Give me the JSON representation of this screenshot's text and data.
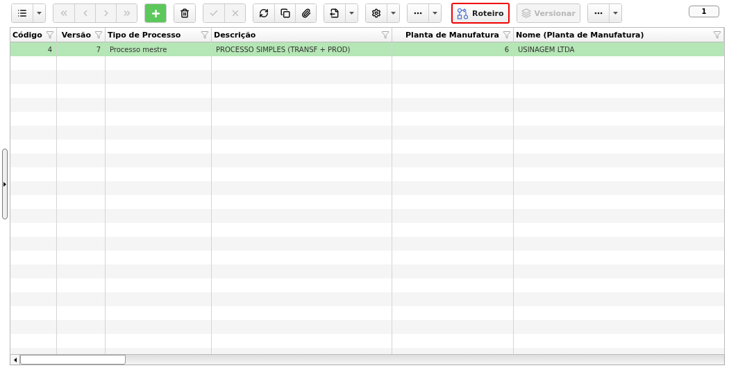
{
  "toolbar": {
    "groups": [
      {
        "buttons": [
          {
            "kind": "list",
            "disabled": false
          },
          {
            "kind": "caret",
            "disabled": false
          }
        ]
      },
      {
        "buttons": [
          {
            "kind": "first",
            "disabled": true
          },
          {
            "kind": "prev",
            "disabled": true
          },
          {
            "kind": "next",
            "disabled": true
          },
          {
            "kind": "last",
            "disabled": true
          }
        ]
      },
      {
        "buttons": [
          {
            "kind": "add",
            "disabled": false
          }
        ]
      },
      {
        "buttons": [
          {
            "kind": "delete",
            "disabled": false
          }
        ]
      },
      {
        "buttons": [
          {
            "kind": "confirm",
            "disabled": true
          },
          {
            "kind": "cancel",
            "disabled": true
          }
        ]
      },
      {
        "buttons": [
          {
            "kind": "refresh",
            "disabled": false
          },
          {
            "kind": "copy",
            "disabled": false
          },
          {
            "kind": "attach",
            "disabled": false
          }
        ]
      },
      {
        "buttons": [
          {
            "kind": "export",
            "disabled": false
          },
          {
            "kind": "caret",
            "disabled": false
          }
        ]
      },
      {
        "buttons": [
          {
            "kind": "settings",
            "disabled": false
          },
          {
            "kind": "caret",
            "disabled": false
          }
        ]
      },
      {
        "buttons": [
          {
            "kind": "more",
            "disabled": false
          },
          {
            "kind": "caret",
            "disabled": false
          }
        ]
      },
      {
        "buttons": [
          {
            "kind": "route",
            "label": "Roteiro",
            "disabled": false,
            "highlighted": true
          }
        ]
      },
      {
        "buttons": [
          {
            "kind": "layers",
            "label": "Versionar",
            "disabled": true,
            "highlighted": false
          }
        ]
      },
      {
        "buttons": [
          {
            "kind": "more",
            "disabled": false
          },
          {
            "kind": "caret",
            "disabled": false
          }
        ]
      }
    ],
    "page_badge": "1"
  },
  "table": {
    "columns": [
      {
        "label": "Código"
      },
      {
        "label": "Versão"
      },
      {
        "label": "Tipo de Processo"
      },
      {
        "label": "Descrição"
      },
      {
        "label": "Planta de Manufatura"
      },
      {
        "label": "Nome (Planta de Manufatura)"
      }
    ],
    "rows": [
      {
        "selected": true,
        "cells": [
          "4",
          "7",
          "Processo mestre",
          "PROCESSO SIMPLES (TRANSF + PROD)",
          "6",
          "USINAGEM LTDA"
        ]
      }
    ]
  }
}
